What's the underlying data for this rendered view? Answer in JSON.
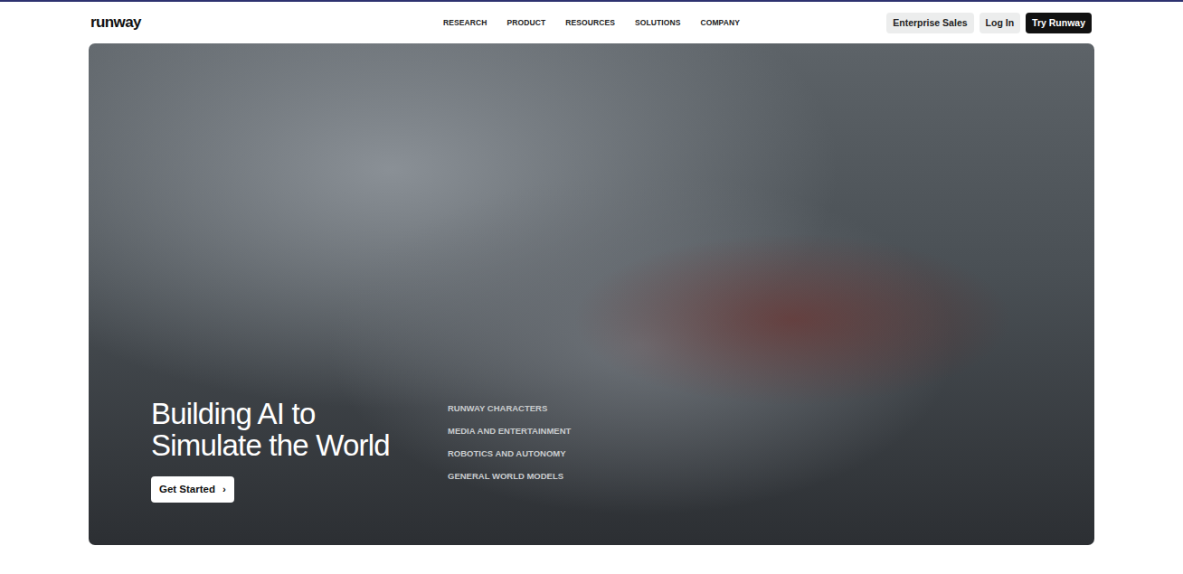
{
  "header": {
    "logo": "runway",
    "nav": [
      {
        "label": "RESEARCH"
      },
      {
        "label": "PRODUCT"
      },
      {
        "label": "RESOURCES"
      },
      {
        "label": "SOLUTIONS"
      },
      {
        "label": "COMPANY"
      }
    ],
    "actions": [
      {
        "label": "Enterprise Sales",
        "kind": "light"
      },
      {
        "label": "Log In",
        "kind": "light"
      },
      {
        "label": "Try Runway",
        "kind": "dark"
      }
    ]
  },
  "hero": {
    "headline": [
      "Building AI to",
      "Simulate the World"
    ],
    "cta": {
      "label": "Get Started",
      "icon": "›"
    },
    "topics": [
      "RUNWAY CHARACTERS",
      "MEDIA AND ENTERTAINMENT",
      "ROBOTICS AND AUTONOMY",
      "GENERAL WORLD MODELS"
    ]
  }
}
